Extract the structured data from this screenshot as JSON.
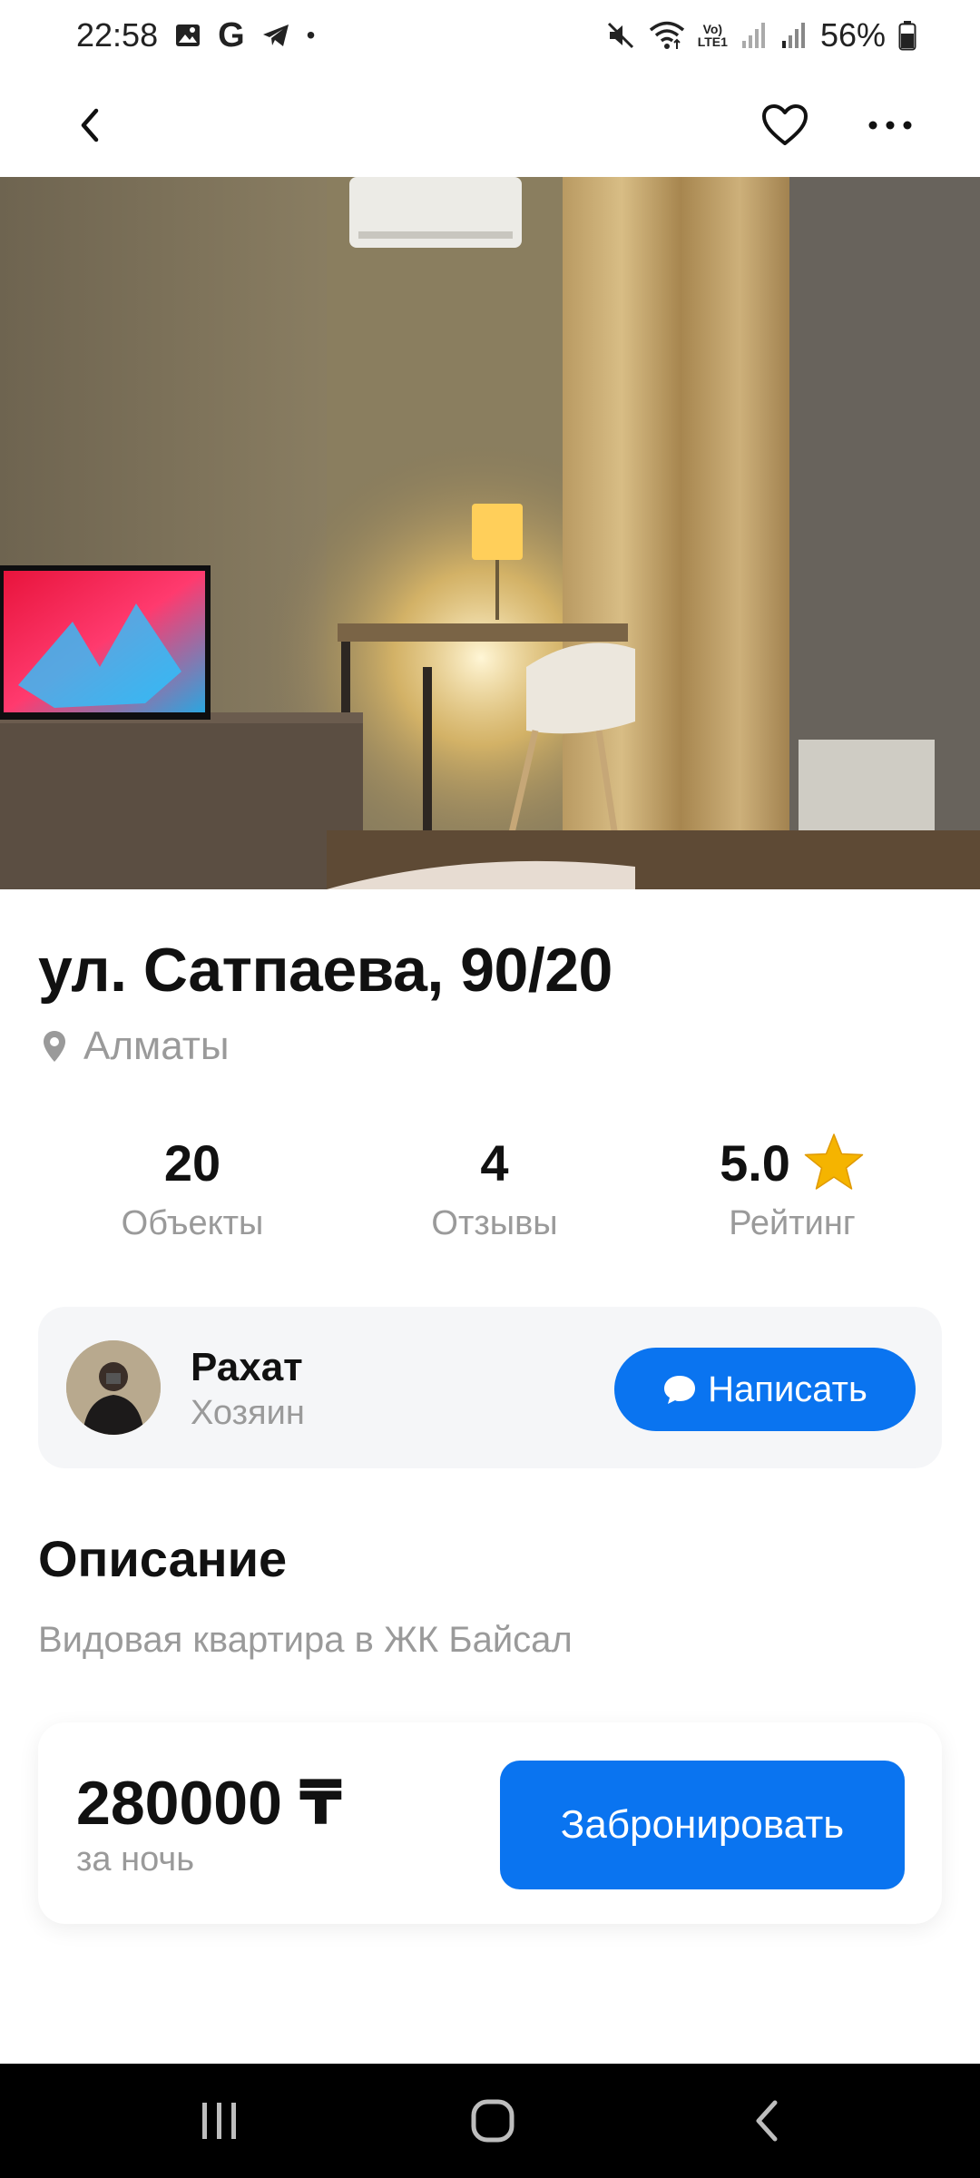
{
  "status_bar": {
    "time": "22:58",
    "battery": "56%",
    "volte_top": "Vo)",
    "volte_bottom": "LTE1",
    "icons": [
      "gallery-icon",
      "google-icon",
      "telegram-icon",
      "notification-dot-icon",
      "mute-icon",
      "wifi-icon",
      "signal-icon",
      "signal-icon",
      "battery-icon"
    ],
    "google_letter": "G",
    "dot": "•"
  },
  "nav": {
    "back_icon": "chevron-left-icon",
    "favorite_icon": "heart-icon",
    "more_icon": "more-horizontal-icon"
  },
  "hero": {
    "page_count": 1,
    "current_page": 1
  },
  "listing": {
    "title": "ул. Сатпаева, 90/20",
    "city": "Алматы",
    "city_icon": "location-pin-icon"
  },
  "stats": [
    {
      "value": "20",
      "label": "Объекты"
    },
    {
      "value": "4",
      "label": "Отзывы"
    },
    {
      "value": "5.0",
      "label": "Рейтинг",
      "icon": "star-icon"
    }
  ],
  "host": {
    "name": "Рахат",
    "role": "Хозяин",
    "message_label": "Написать",
    "message_icon": "chat-bubble-icon"
  },
  "description": {
    "heading": "Описание",
    "text": "Видовая квартира в ЖК Байсал"
  },
  "booking": {
    "price": "280000 ₸",
    "unit": "за ночь",
    "button_label": "Забронировать"
  },
  "colors": {
    "accent": "#0a74f0",
    "muted_text": "#9a9a9a",
    "card_bg": "#f5f6f8",
    "star": "#f5b400"
  }
}
